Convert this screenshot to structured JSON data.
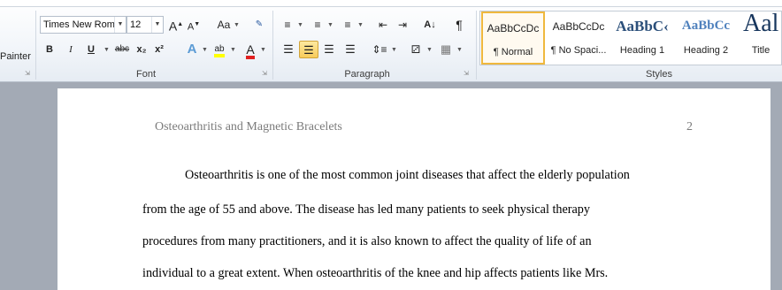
{
  "clipboard": {
    "painter_label": "Painter"
  },
  "font": {
    "family": "Times New Rom",
    "size": "12",
    "grow_glyph": "A",
    "shrink_glyph": "A",
    "case_label": "Aa",
    "bold": "B",
    "italic": "I",
    "underline": "U",
    "strike": "abc",
    "subscript": "x₂",
    "superscript": "x²",
    "effects_glyph": "A",
    "highlight_glyph": "ab",
    "font_color_glyph": "A",
    "group_label": "Font"
  },
  "paragraph": {
    "sort_glyph": "A↓",
    "pilcrow": "¶",
    "group_label": "Paragraph"
  },
  "styles": {
    "group_label": "Styles",
    "items": [
      {
        "sample": "AaBbCcDc",
        "name": "¶ Normal"
      },
      {
        "sample": "AaBbCcDc",
        "name": "¶ No Spaci..."
      },
      {
        "sample": "AaBbC‹",
        "name": "Heading 1"
      },
      {
        "sample": "AaBbCc",
        "name": "Heading 2"
      },
      {
        "sample": "Aal",
        "name": "Title"
      }
    ]
  },
  "document": {
    "running_head": "Osteoarthritis and Magnetic Bracelets",
    "page_number": "2",
    "lines": [
      "Osteoarthritis is one of the most common joint diseases that affect the elderly population",
      "from the age of 55 and above. The disease has led many patients to seek physical therapy",
      "procedures from many practitioners, and it is also known to affect the quality of life of an",
      "individual to a great extent. When osteoarthritis of the knee and hip affects patients like Mrs."
    ]
  },
  "colors": {
    "highlight": "#ffff00",
    "font_color": "#e02020",
    "selected_button": "#f8cb5a",
    "page_bg": "#a3aab5"
  }
}
